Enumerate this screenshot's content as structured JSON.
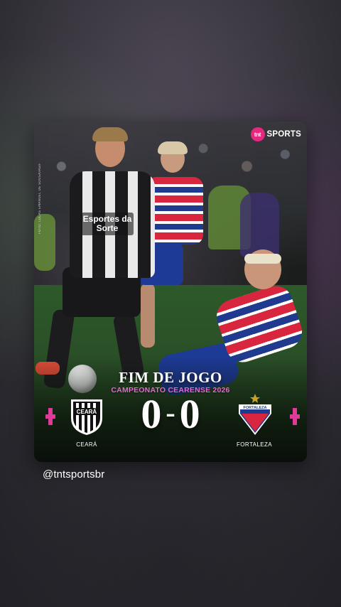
{
  "post": {
    "brand": {
      "icon_text": "tnt",
      "label": "SPORTS"
    },
    "photo_credit": "FOTO: LUCAS EMANUEL DE SOUSA/AGIF",
    "sponsor_text": "Esportes da Sorte",
    "match_status": "FIM DE JOGO",
    "competition": "CAMPEONATO CEARENSE 2026",
    "home_team": {
      "name": "CEARÁ",
      "crest_text": "CEARÁ"
    },
    "away_team": {
      "name": "FORTALEZA",
      "crest_text": "FORTALEZA"
    },
    "score": {
      "home": "0",
      "separator": "-",
      "away": "0"
    },
    "accent_color": "#e1399a"
  },
  "caption": {
    "handle": "@tntsportsbr"
  }
}
